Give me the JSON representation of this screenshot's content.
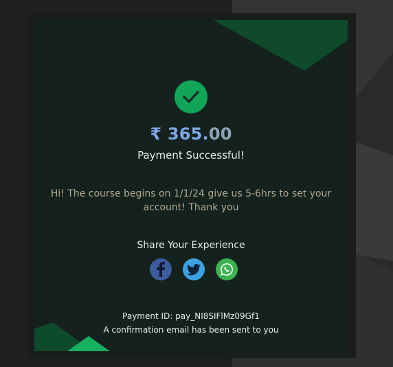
{
  "payment": {
    "currency_symbol": "₹",
    "amount_whole": "365.",
    "amount_decimal": "00",
    "status": "Payment Successful!",
    "message": "Hi! The course begins on 1/1/24 give us 5-6hrs to set your account! Thank you",
    "payment_id": "Payment ID: pay_NI8SIFlMz09Gf1",
    "confirmation": "A confirmation email has been sent to you"
  },
  "share": {
    "title": "Share Your Experience",
    "icons": [
      "facebook-icon",
      "twitter-icon",
      "whatsapp-icon"
    ]
  },
  "colors": {
    "success_green": "#12a558",
    "amount_blue": "#7ba7e6",
    "card_bg": "#14211d",
    "facebook": "#3b5c9f",
    "twitter": "#3da2e4",
    "whatsapp": "#3bb24f"
  }
}
